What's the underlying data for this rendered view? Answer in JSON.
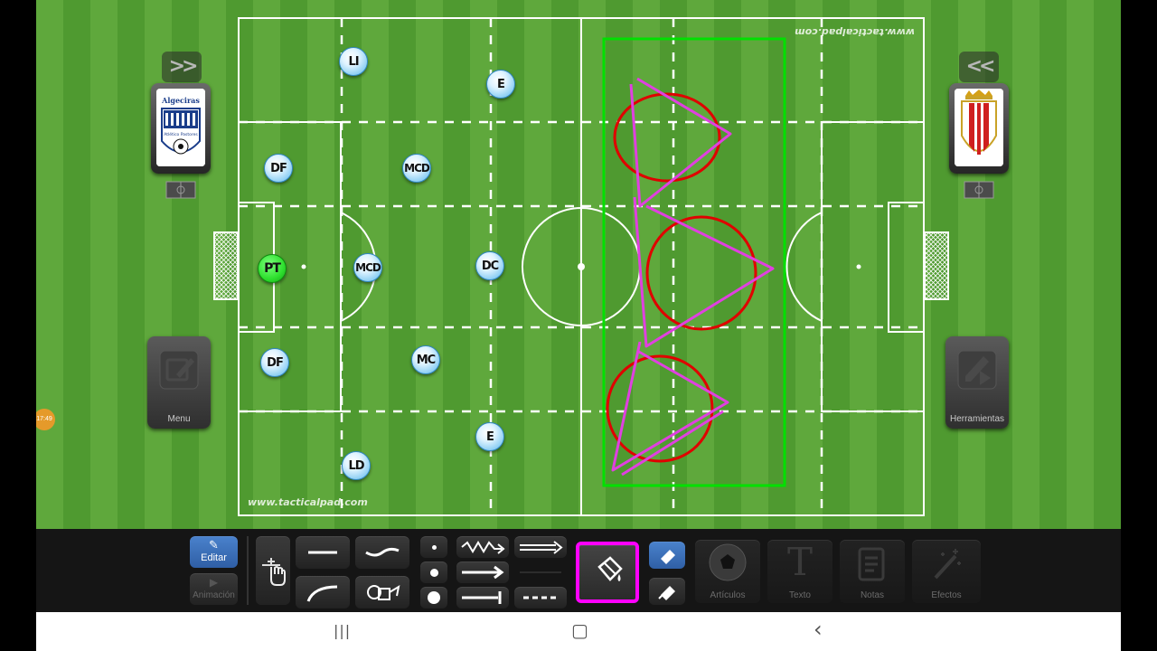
{
  "field": {
    "watermark_bottom": "www.tacticalpad.com",
    "watermark_top": "www.tacticalpad.com"
  },
  "players": [
    {
      "label": "LI"
    },
    {
      "label": "E"
    },
    {
      "label": "DF"
    },
    {
      "label": "MCD"
    },
    {
      "label": "PT"
    },
    {
      "label": "MCD"
    },
    {
      "label": "DC"
    },
    {
      "label": "DF"
    },
    {
      "label": "MC"
    },
    {
      "label": "E"
    },
    {
      "label": "LD"
    }
  ],
  "left_panel": {
    "team_logo": {
      "name_text": "Algeciras",
      "sub_text": "Atlético Pastores"
    },
    "menu_label": "Menu",
    "expand_icon": "double-chevron-right-icon"
  },
  "right_panel": {
    "team_logo_icon": "algeciras-cf-crest",
    "tools_label": "Herramientas",
    "expand_icon": "double-chevron-left-icon"
  },
  "clock_badge": "17:49",
  "toolbar": {
    "edit_label": "Editar",
    "animation_label": "Animación",
    "balls_label": "Artículos",
    "text_label": "Texto",
    "notes_label": "Notas",
    "effects_label": "Efectos",
    "text_icon_glyph": "T"
  },
  "colors": {
    "selection_box": "#00e000",
    "circle": "#e00000",
    "zigzag": "#e040e0",
    "active_tool": "#ff00ff",
    "edit_active": "#3a6fb8"
  },
  "navbar": {
    "recent_icon": "|||",
    "home_icon": "▢",
    "back_icon": "‹"
  }
}
